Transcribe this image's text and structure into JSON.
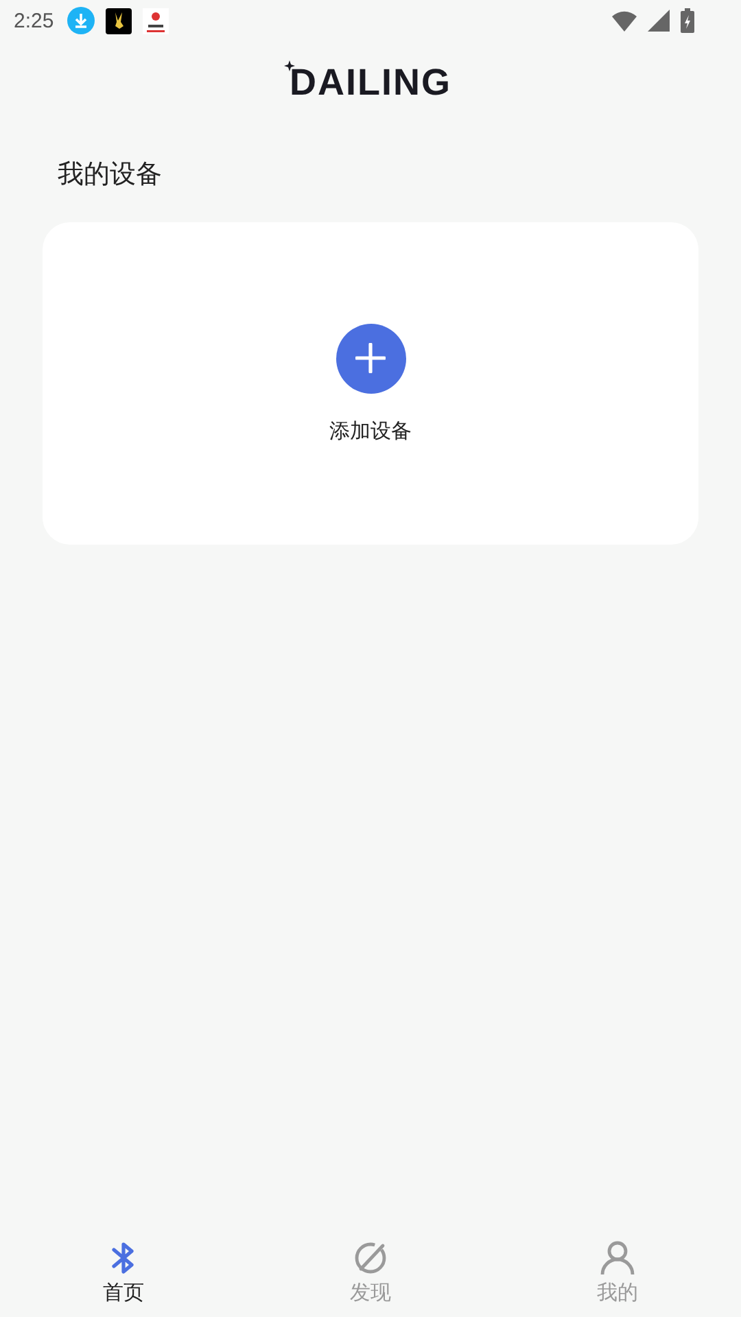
{
  "status_bar": {
    "time": "2:25"
  },
  "header": {
    "logo": "DAILING"
  },
  "section_title": "我的设备",
  "add_device": {
    "label": "添加设备"
  },
  "tabs": [
    {
      "label": "首页",
      "selected": true
    },
    {
      "label": "发现",
      "selected": false
    },
    {
      "label": "我的",
      "selected": false
    }
  ]
}
